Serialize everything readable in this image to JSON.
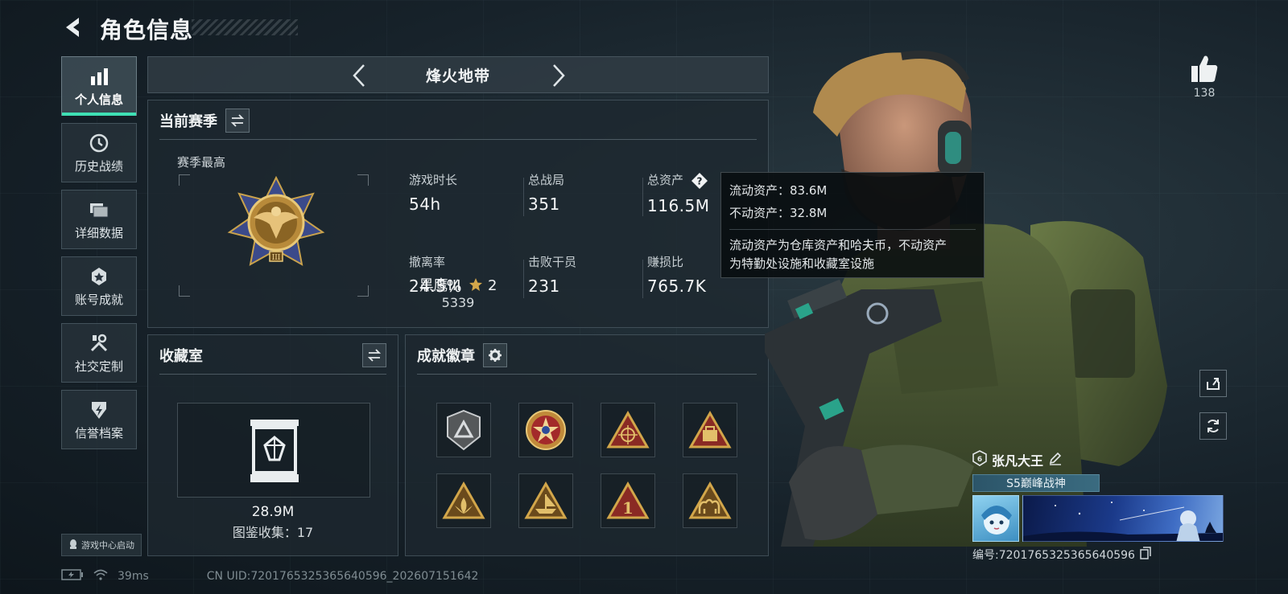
{
  "header": {
    "title": "角色信息"
  },
  "sidebar": {
    "items": [
      {
        "label": "个人信息",
        "icon": "bar-chart-icon",
        "active": true
      },
      {
        "label": "历史战绩",
        "icon": "history-clock-icon"
      },
      {
        "label": "详细数据",
        "icon": "folder-icon"
      },
      {
        "label": "账号成就",
        "icon": "achievement-icon"
      },
      {
        "label": "社交定制",
        "icon": "tools-icon"
      },
      {
        "label": "信誉档案",
        "icon": "shield-icon"
      }
    ],
    "launch_badge": "游戏中心启动"
  },
  "status": {
    "ping": "39ms",
    "uid_text": "CN UID:7201765325365640596_202607151642"
  },
  "mode": {
    "title": "烽火地带"
  },
  "season": {
    "title": "当前赛季",
    "best_label": "赛季最高",
    "rank_name": "黑鹰III",
    "rank_stars": "2",
    "rank_score": "5339",
    "stats": [
      {
        "label": "游戏时长",
        "value": "54h"
      },
      {
        "label": "总战局",
        "value": "351"
      },
      {
        "label": "总资产",
        "value": "116.5M"
      },
      {
        "label": "撤离率",
        "value": "24.5%"
      },
      {
        "label": "击败干员",
        "value": "231"
      },
      {
        "label": "赚损比",
        "value": "765.7K"
      }
    ]
  },
  "tooltip": {
    "liquid": "流动资产：83.6M",
    "fixed": "不动资产：32.8M",
    "description_line1": "流动资产为仓库资产和哈夫币，不动资产",
    "description_line2": "为特勤处设施和收藏室设施"
  },
  "collection": {
    "title": "收藏室",
    "value": "28.9M",
    "count_text": "图鉴收集：17"
  },
  "badges": {
    "title": "成就徽章",
    "items": [
      "silver-chevron-badge",
      "red-star-badge",
      "scope-triangle-badge",
      "gold-bag-badge",
      "lotus-triangle-badge",
      "ship-triangle-badge",
      "number-one-badge",
      "camel-triangle-badge"
    ]
  },
  "social": {
    "like_count": "138"
  },
  "player": {
    "name": "张凡大王",
    "title": "S5巅峰战神",
    "id_text": "编号:7201765325365640596"
  },
  "colors": {
    "accent": "#3fe0b4",
    "gold": "#d2a64a",
    "background": "#17222a"
  }
}
